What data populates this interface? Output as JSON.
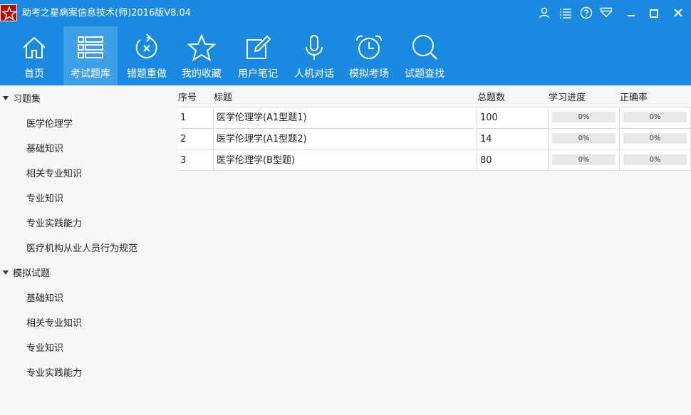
{
  "window": {
    "title": "助考之星病案信息技术(师)2016版V8.04",
    "accent_color": "#1a8ae0",
    "controls": [
      "user-icon",
      "menu-icon",
      "help-icon",
      "skin-icon",
      "minimize-icon",
      "maximize-icon",
      "close-icon"
    ]
  },
  "toolbar": {
    "items": [
      {
        "label": "首页",
        "icon": "home-icon"
      },
      {
        "label": "考试题库",
        "icon": "question-bank-icon",
        "active": true
      },
      {
        "label": "错题重做",
        "icon": "redo-icon"
      },
      {
        "label": "我的收藏",
        "icon": "star-icon"
      },
      {
        "label": "用户笔记",
        "icon": "notes-icon"
      },
      {
        "label": "人机对话",
        "icon": "microphone-icon"
      },
      {
        "label": "模拟考场",
        "icon": "alarm-clock-icon"
      },
      {
        "label": "试题查找",
        "icon": "search-icon"
      }
    ]
  },
  "sidebar": {
    "groups": [
      {
        "label": "习题集",
        "items": [
          "医学伦理学",
          "基础知识",
          "相关专业知识",
          "专业知识",
          "专业实践能力",
          "医疗机构从业人员行为规范"
        ]
      },
      {
        "label": "模拟试题",
        "items": [
          "基础知识",
          "相关专业知识",
          "专业知识",
          "专业实践能力"
        ]
      }
    ]
  },
  "table": {
    "headers": [
      "序号",
      "标题",
      "总题数",
      "学习进度",
      "正确率"
    ],
    "rows": [
      {
        "index": "1",
        "title": "医学伦理学(A1型题1)",
        "total": "100",
        "progress": "0%",
        "progress_value": 0,
        "accuracy": "0%",
        "accuracy_value": 0
      },
      {
        "index": "2",
        "title": "医学伦理学(A1型题2)",
        "total": "14",
        "progress": "0%",
        "progress_value": 0,
        "accuracy": "0%",
        "accuracy_value": 0
      },
      {
        "index": "3",
        "title": "医学伦理学(B型题)",
        "total": "80",
        "progress": "0%",
        "progress_value": 0,
        "accuracy": "0%",
        "accuracy_value": 0
      }
    ]
  }
}
